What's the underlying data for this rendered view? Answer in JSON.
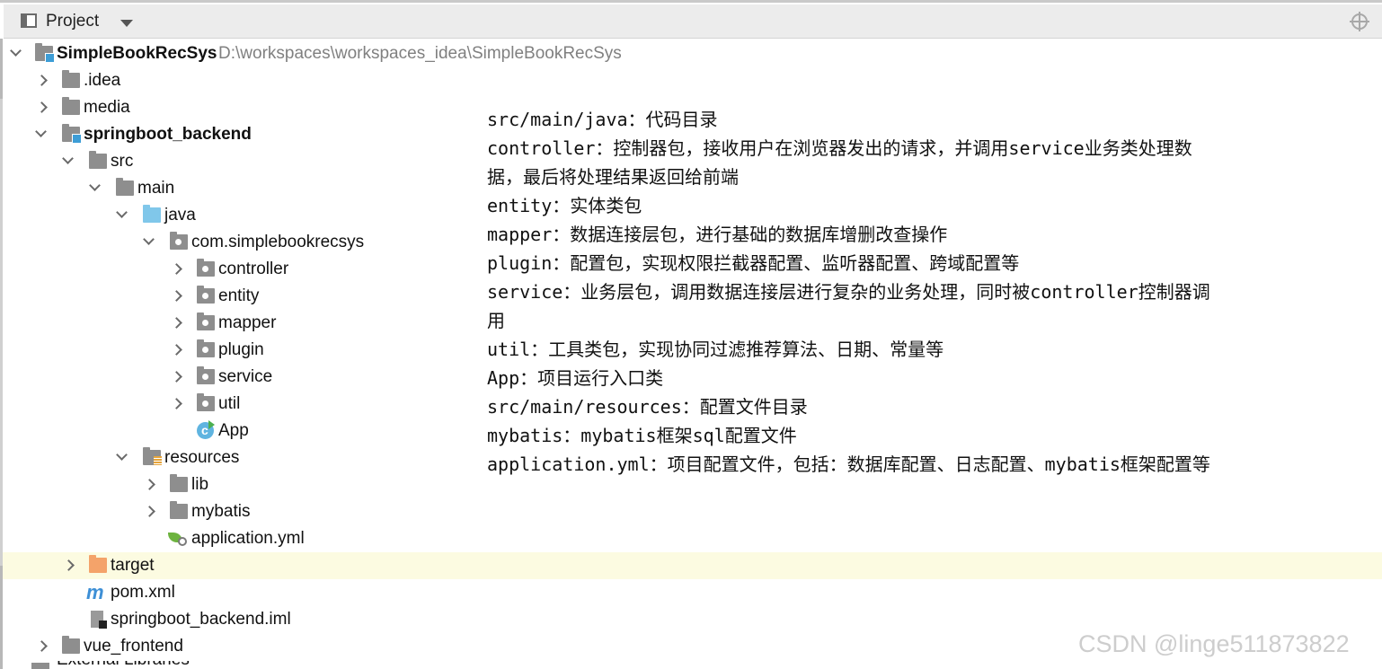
{
  "panel": {
    "title": "Project"
  },
  "tree": {
    "root_name": "SimpleBookRecSys",
    "root_path": "D:\\workspaces\\workspaces_idea\\SimpleBookRecSys",
    "items": [
      {
        "label": ".idea"
      },
      {
        "label": "media"
      },
      {
        "label": "springboot_backend"
      },
      {
        "label": "src"
      },
      {
        "label": "main"
      },
      {
        "label": "java"
      },
      {
        "label": "com.simplebookrecsys"
      },
      {
        "label": "controller"
      },
      {
        "label": "entity"
      },
      {
        "label": "mapper"
      },
      {
        "label": "plugin"
      },
      {
        "label": "service"
      },
      {
        "label": "util"
      },
      {
        "label": "App"
      },
      {
        "label": "resources"
      },
      {
        "label": "lib"
      },
      {
        "label": "mybatis"
      },
      {
        "label": "application.yml"
      },
      {
        "label": "target"
      },
      {
        "label": "pom.xml"
      },
      {
        "label": "springboot_backend.iml"
      },
      {
        "label": "vue_frontend"
      },
      {
        "label": "External Libraries"
      }
    ]
  },
  "notes": [
    "src/main/java：代码目录",
    "controller：控制器包，接收用户在浏览器发出的请求，并调用service业务类处理数",
    "据，最后将处理结果返回给前端",
    "entity：实体类包",
    "mapper：数据连接层包，进行基础的数据库增删改查操作",
    "plugin：配置包，实现权限拦截器配置、监听器配置、跨域配置等",
    "service：业务层包，调用数据连接层进行复杂的业务处理，同时被controller控制器调",
    "用",
    "util：工具类包，实现协同过滤推荐算法、日期、常量等",
    "App：项目运行入口类",
    "src/main/resources：配置文件目录",
    "mybatis：mybatis框架sql配置文件",
    "application.yml：项目配置文件，包括：数据库配置、日志配置、mybatis框架配置等"
  ],
  "watermark": "CSDN @linge511873822"
}
